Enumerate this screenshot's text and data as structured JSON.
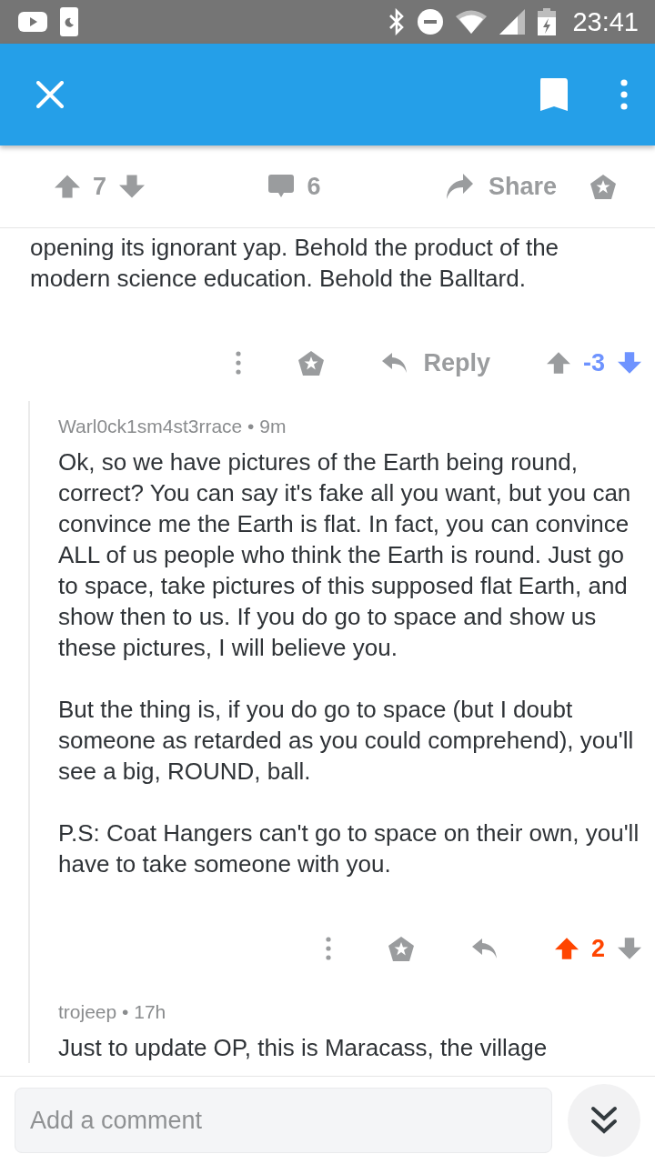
{
  "status_bar": {
    "time": "23:41"
  },
  "post_actions": {
    "score": "7",
    "upvoted": false,
    "downvoted": false,
    "comments": "6",
    "share": "Share"
  },
  "comments": [
    {
      "kind": "tail",
      "paragraphs": [
        "opening its ignorant yap. Behold the product of the modern science education. Behold the Balltard."
      ],
      "actions": {
        "reply": "Reply",
        "score": "-3",
        "upvoted": false,
        "downvoted": true
      }
    },
    {
      "kind": "reply",
      "byline": "Warl0ck1sm4st3rrace • 9m",
      "paragraphs": [
        "Ok, so we have pictures of the Earth being round, correct? You can say it's fake all you want, but you can convince me the Earth is flat. In fact, you can convince ALL of us people who think the Earth is round. Just go to space, take pictures of this supposed flat Earth, and show then to us. If you do go to space and show us these pictures, I will believe you.",
        "But the thing is, if you do go to space (but I doubt someone as retarded as you could comprehend), you'll see a big, ROUND, ball.",
        "P.S: Coat Hangers can't go to space on their own, you'll have to take someone with you."
      ],
      "actions": {
        "score": "2",
        "upvoted": true,
        "downvoted": false
      }
    },
    {
      "kind": "reply",
      "byline": "trojeep • 17h",
      "paragraphs": [
        "Just to update OP, this is Maracass, the village"
      ]
    }
  ],
  "composer": {
    "placeholder": "Add a comment"
  }
}
